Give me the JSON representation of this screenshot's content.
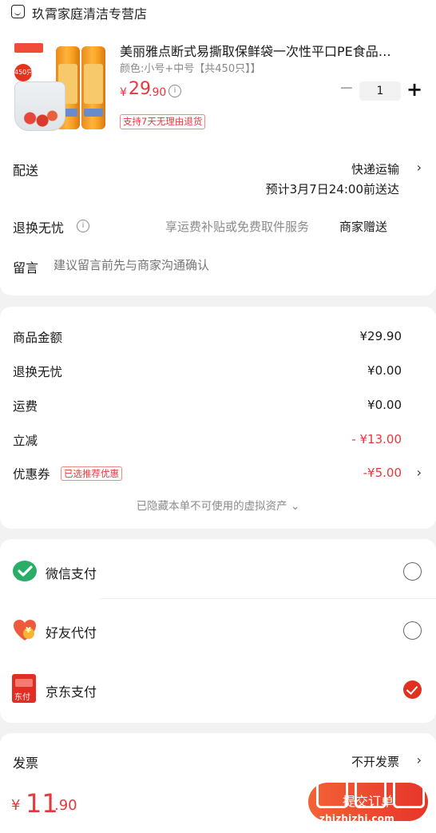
{
  "store": {
    "name": "玖霄家庭清洁专营店"
  },
  "product": {
    "title": "美丽雅点断式易撕取保鲜袋一次性平口PE食品…",
    "spec": "颜色:小号+中号【共450只】】",
    "price_yen": "¥",
    "price_int": "29",
    "price_dec": ".90",
    "quantity": "1",
    "minus": "−",
    "plus": "+",
    "return_tag": "支持7天无理由退货",
    "image_badge": "450只"
  },
  "delivery": {
    "label": "配送",
    "method": "快递运输",
    "eta": "预计3月7日24:00前送达"
  },
  "return_service": {
    "label": "退换无忧",
    "desc": "享运费补贴或免费取件服务",
    "value": "商家赠送"
  },
  "message": {
    "label": "留言",
    "placeholder": "建议留言前先与商家沟通确认"
  },
  "amounts": {
    "rows": [
      {
        "label": "商品金额",
        "value": "¥29.90"
      },
      {
        "label": "退换无忧",
        "value": "¥0.00"
      },
      {
        "label": "运费",
        "value": "¥0.00"
      },
      {
        "label": "立减",
        "value": "- ¥13.00"
      },
      {
        "label": "优惠券",
        "value": "-¥5.00",
        "tag": "已选推荐优惠"
      }
    ],
    "hidden_note": "已隐藏本单不可使用的虚拟资产 ⌄"
  },
  "payment": {
    "options": [
      {
        "label": "微信支付",
        "icon": "wechat-pay-icon",
        "selected": false
      },
      {
        "label": "好友代付",
        "icon": "friend-pay-icon",
        "selected": false
      },
      {
        "label": "京东支付",
        "icon": "jd-pay-icon",
        "selected": true
      }
    ],
    "jd_icon_text": "东付",
    "friend_icon_text": "¥"
  },
  "invoice": {
    "label": "发票",
    "value": "不开发票"
  },
  "bottom": {
    "total_yen": "¥",
    "total_int": "11",
    "total_dec": ".90",
    "submit_label": "提交订单",
    "watermark": "zhizhizhi.com"
  },
  "colors": {
    "accent": "#e4393c",
    "wechat": "#2aae67",
    "jd_pay": "#e02e24",
    "friend_pay": "#f05a3c"
  }
}
